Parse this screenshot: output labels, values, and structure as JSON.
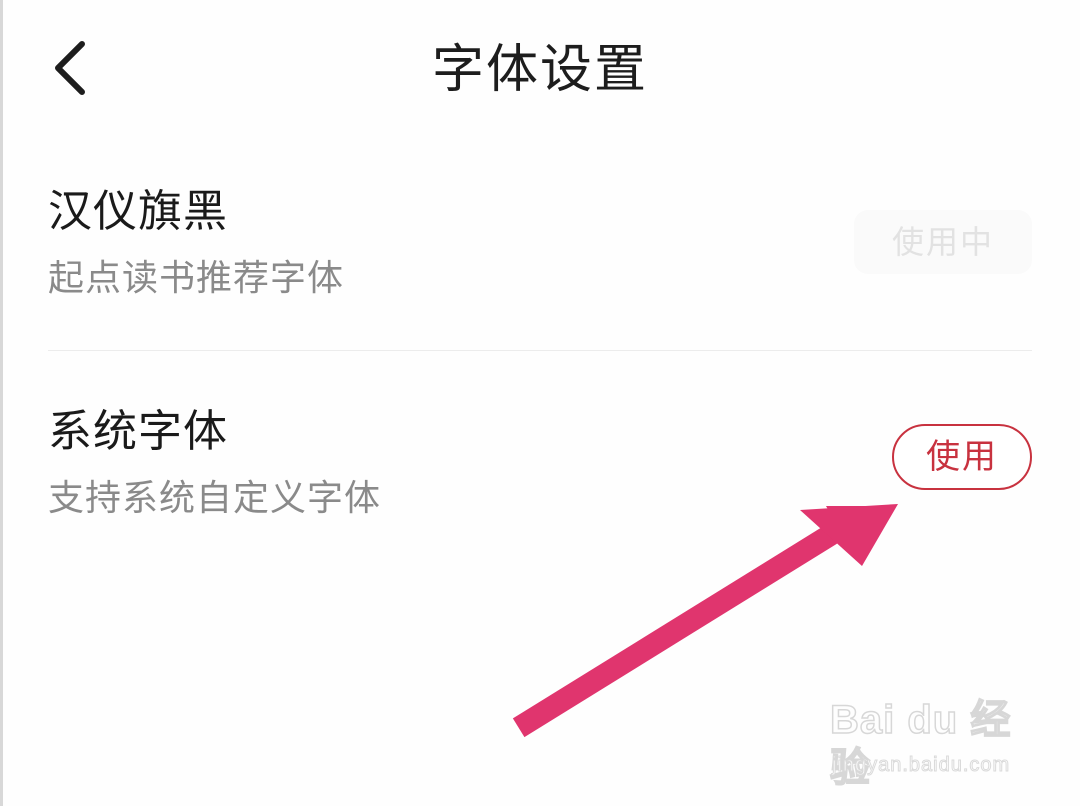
{
  "header": {
    "title": "字体设置",
    "back_icon": "chevron-left-icon"
  },
  "fonts": [
    {
      "name": "汉仪旗黑",
      "description": "起点读书推荐字体",
      "action_label": "使用中",
      "active": true
    },
    {
      "name": "系统字体",
      "description": "支持系统自定义字体",
      "action_label": "使用",
      "active": false
    }
  ],
  "annotation": {
    "arrow_color": "#e0356e",
    "arrow_icon": "pointer-arrow-icon"
  },
  "watermark": {
    "brand": "Bai du 经验",
    "url": "jingyan.baidu.com"
  },
  "colors": {
    "accent": "#c8323f",
    "text_primary": "#1a1a1a",
    "text_secondary": "#8a8a8a",
    "disabled": "#e2e2e2"
  }
}
